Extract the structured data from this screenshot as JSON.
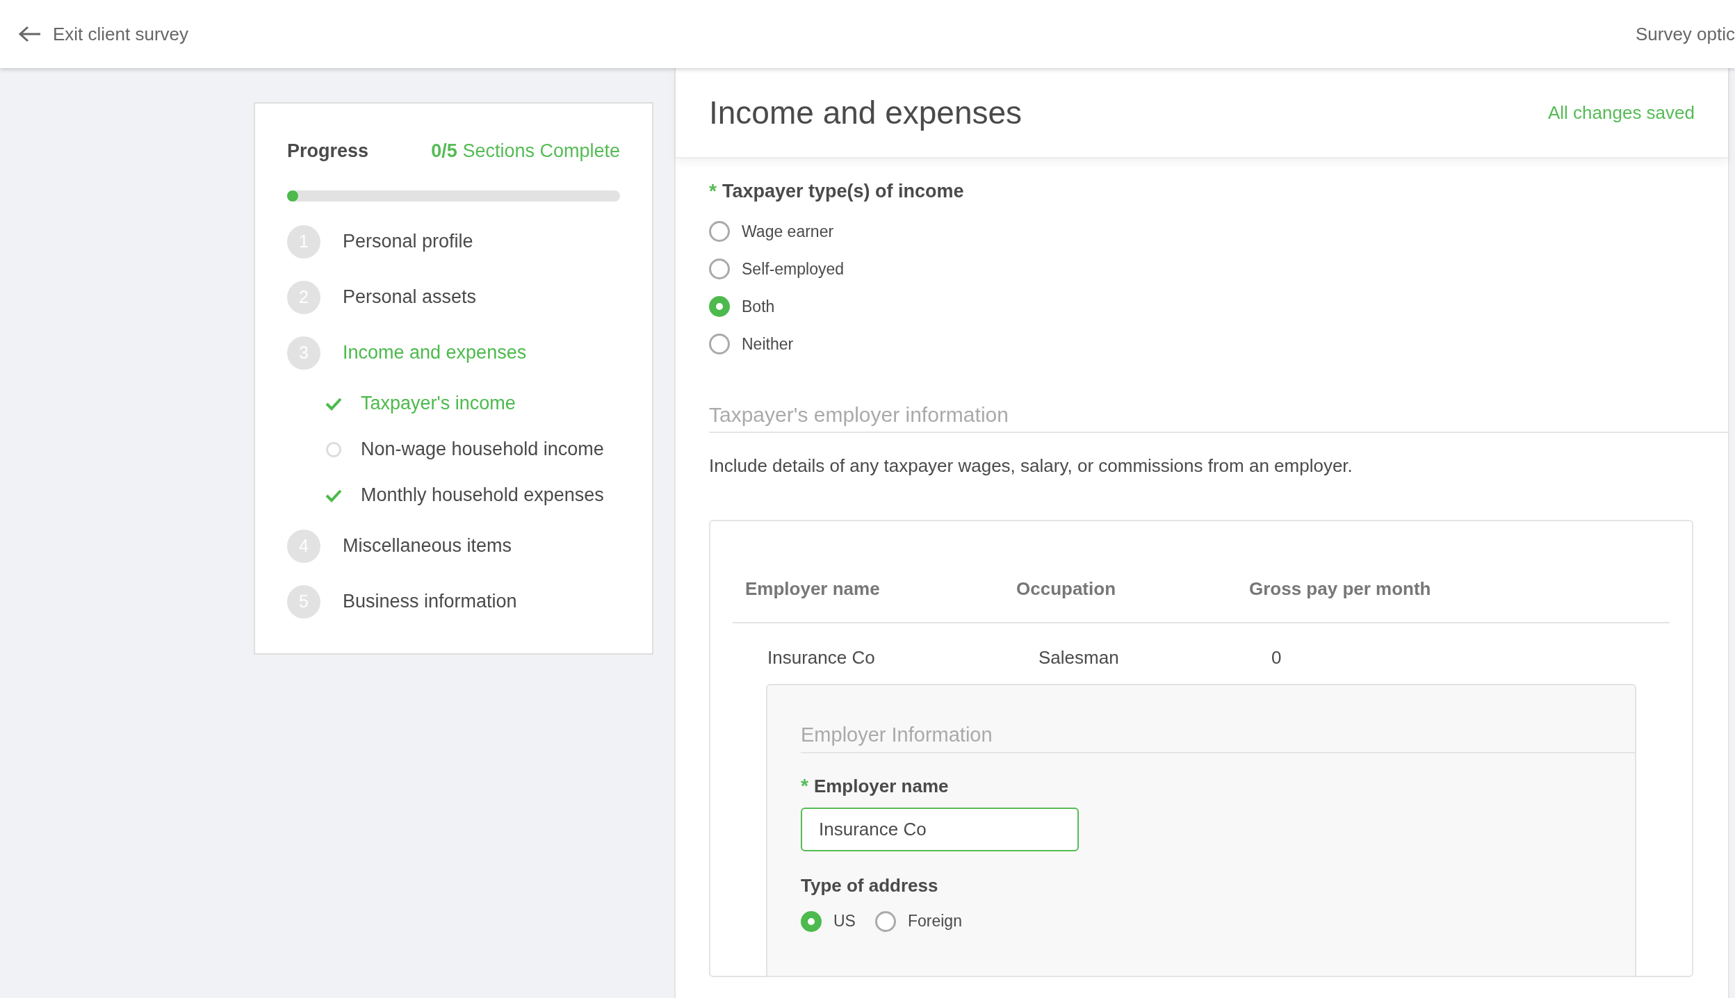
{
  "top_bar": {
    "back_label": "Exit client survey",
    "menu_label": "Survey optic"
  },
  "progress": {
    "title": "Progress",
    "count": "0/5",
    "count_suffix": "Sections Complete",
    "level": 0,
    "sections": [
      {
        "number": "1",
        "label": "Personal profile",
        "selected": false
      },
      {
        "number": "2",
        "label": "Personal assets",
        "selected": false
      },
      {
        "number": "3",
        "label": "Income and expenses",
        "selected": true,
        "children": [
          {
            "label": "Taxpayer's income",
            "selected": true,
            "complete": true
          },
          {
            "label": "Non-wage household income",
            "selected": false,
            "complete": false
          },
          {
            "label": "Monthly household expenses",
            "selected": false,
            "complete": true
          }
        ]
      },
      {
        "number": "4",
        "label": "Miscellaneous items",
        "selected": false
      },
      {
        "number": "5",
        "label": "Business information",
        "selected": false
      }
    ]
  },
  "main": {
    "title": "Income and expenses",
    "save_status": "All changes saved",
    "income_type": {
      "required_mark": "*",
      "label": "Taxpayer type(s) of income",
      "options": [
        {
          "label": "Wage earner",
          "selected": false
        },
        {
          "label": "Self-employed",
          "selected": false
        },
        {
          "label": "Both",
          "selected": true
        },
        {
          "label": "Neither",
          "selected": false
        }
      ]
    },
    "employer_section": {
      "title": "Taxpayer's employer information",
      "description": "Include details of any taxpayer wages, salary, or commissions from an employer.",
      "table": {
        "columns": [
          "Employer name",
          "Occupation",
          "Gross pay per month"
        ],
        "rows": [
          [
            "Insurance Co",
            "Salesman",
            "0"
          ]
        ]
      },
      "detail": {
        "title": "Employer Information",
        "employer_name": {
          "required_mark": "*",
          "label": "Employer name",
          "value": "Insurance Co"
        },
        "address_type": {
          "label": "Type of address",
          "options": [
            {
              "label": "US",
              "selected": true
            },
            {
              "label": "Foreign",
              "selected": false
            }
          ]
        }
      }
    }
  }
}
